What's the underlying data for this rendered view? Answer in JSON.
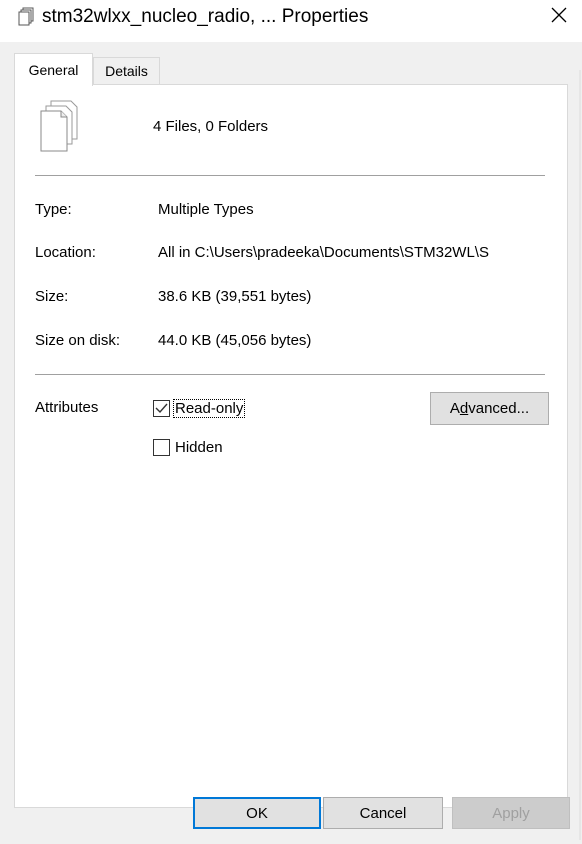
{
  "window": {
    "title": "stm32wlxx_nucleo_radio, ... Properties",
    "close_icon": "close-icon",
    "title_icon": "multiple-files-icon"
  },
  "tabs": [
    {
      "label": "General",
      "selected": true
    },
    {
      "label": "Details",
      "selected": false
    }
  ],
  "general": {
    "file_icon": "multiple-files-icon",
    "summary": "4 Files, 0 Folders",
    "fields": [
      {
        "label": "Type:",
        "value": "Multiple Types"
      },
      {
        "label": "Location:",
        "value": "All in C:\\Users\\pradeeka\\Documents\\STM32WL\\S"
      },
      {
        "label": "Size:",
        "value": "38.6 KB (39,551 bytes)"
      },
      {
        "label": "Size on disk:",
        "value": "44.0 KB (45,056 bytes)"
      }
    ],
    "attributes": {
      "label": "Attributes",
      "readonly": {
        "label": "Read-only",
        "checked": true
      },
      "hidden": {
        "label": "Hidden",
        "checked": false
      },
      "advanced_label": "Advanced...",
      "advanced_prefix": "A",
      "advanced_access": "d",
      "advanced_rest": "vanced..."
    }
  },
  "footer": {
    "ok": "OK",
    "cancel": "Cancel",
    "apply": "Apply"
  },
  "colors": {
    "accent": "#0078d7",
    "dialog_bg": "#f0f0f0"
  }
}
